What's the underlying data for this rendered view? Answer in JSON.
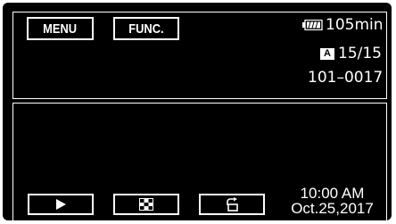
{
  "top_panel": {
    "menu_label": "MENU",
    "func_label": "FUNC.",
    "battery_icon": "battery-full-icon",
    "battery_time": "105min",
    "mode_badge": "A",
    "counter": "15/15",
    "folder_file": "101–0017"
  },
  "bottom_panel": {
    "play_icon": "play-icon",
    "index_icon": "index-grid-icon",
    "rotate_icon": "rotate-icon",
    "time": "10:00 AM",
    "date": "Oct.25,2017"
  },
  "colors": {
    "background": "#000000",
    "foreground": "#ffffff"
  }
}
